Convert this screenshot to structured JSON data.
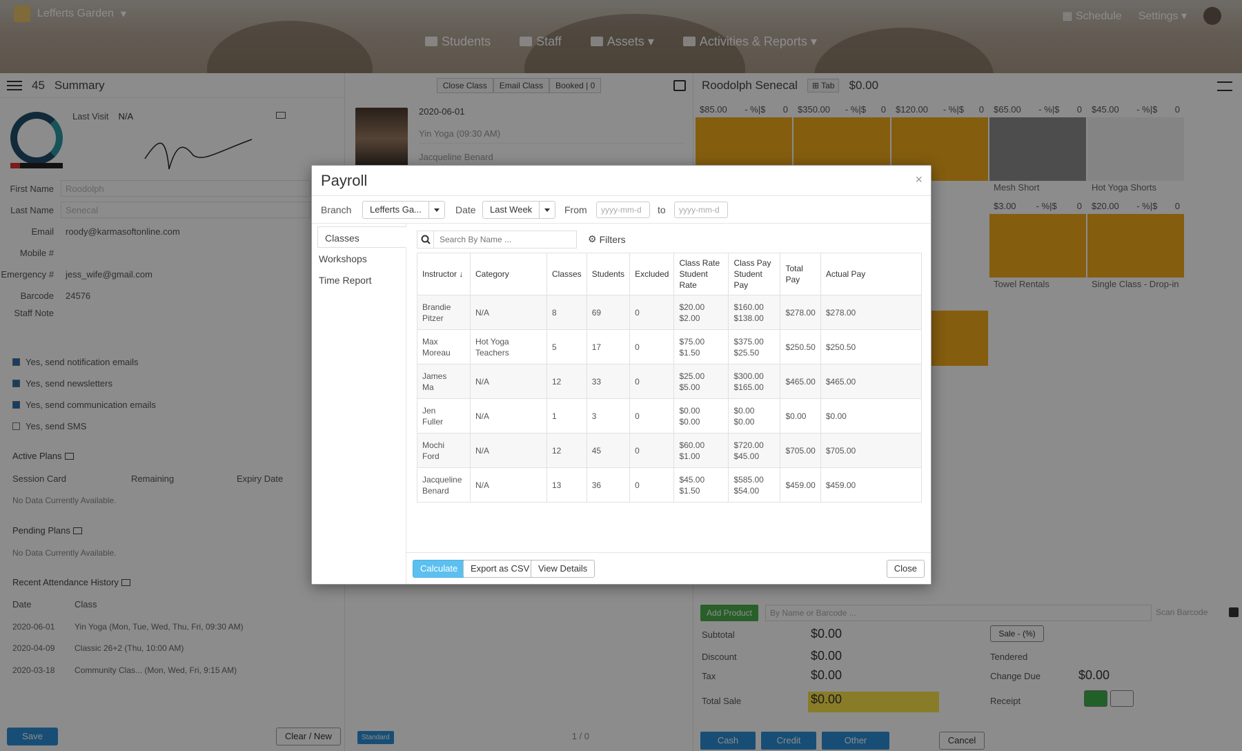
{
  "app": {
    "brand": "Lefferts Garden",
    "nav_right": [
      "Schedule",
      "Settings"
    ],
    "main_nav": [
      "Students",
      "Staff",
      "Assets",
      "Activities & Reports"
    ]
  },
  "summary": {
    "count": "45",
    "title": "Summary",
    "last_visit_label": "Last Visit",
    "last_visit_value": "N/A",
    "fields": [
      {
        "label": "First Name",
        "value": "Roodolph"
      },
      {
        "label": "Last Name",
        "value": "Senecal"
      },
      {
        "label": "Email",
        "value": "roody@karmasoftonline.com"
      },
      {
        "label": "Mobile #",
        "value": ""
      },
      {
        "label": "Emergency #",
        "value": "jess_wife@gmail.com"
      },
      {
        "label": "Barcode",
        "value": "24576"
      },
      {
        "label": "Staff Note",
        "value": ""
      }
    ],
    "checkboxes": [
      {
        "label": "Yes, send notification emails",
        "checked": true
      },
      {
        "label": "Yes, send newsletters",
        "checked": true
      },
      {
        "label": "Yes, send communication emails",
        "checked": true
      },
      {
        "label": "Yes, send SMS",
        "checked": false
      }
    ],
    "active_plans": {
      "title": "Active Plans",
      "columns": [
        "Session Card",
        "Remaining",
        "Expiry Date"
      ],
      "empty": "No Data Currently Available."
    },
    "pending_plans": {
      "title": "Pending Plans",
      "empty": "No Data Currently Available."
    },
    "attendance": {
      "title": "Recent Attendance History",
      "columns": [
        "Date",
        "Class"
      ],
      "rows": [
        {
          "date": "2020-06-01",
          "class": "Yin Yoga (Mon, Tue, Wed, Thu, Fri, 09:30 AM)"
        },
        {
          "date": "2020-04-09",
          "class": "Classic 26+2 (Thu, 10:00 AM)"
        },
        {
          "date": "2020-03-18",
          "class": "Community Clas... (Mon, Wed, Fri, 9:15 AM)"
        }
      ]
    },
    "save_label": "Save",
    "clear_label": "Clear / New"
  },
  "middle": {
    "buttons": [
      "Close Class",
      "Email Class",
      "Booked | 0"
    ],
    "date": "2020-06-01",
    "class_select": "Yin Yoga (09:30 AM)",
    "instructor_select": "Jacqueline Benard",
    "standard_label": "Standard",
    "pager": "1 / 0"
  },
  "pos": {
    "customer": "Roodolph Senecal",
    "tab_label": "Tab",
    "balance": "$0.00",
    "tiles_row1": [
      {
        "price": "$85.00",
        "pct": "- %|$",
        "qty": "0",
        "name": ""
      },
      {
        "price": "$350.00",
        "pct": "- %|$",
        "qty": "0",
        "name": ""
      },
      {
        "price": "$120.00",
        "pct": "- %|$",
        "qty": "0",
        "name": ""
      },
      {
        "price": "$65.00",
        "pct": "- %|$",
        "qty": "0",
        "name": "Mesh Short"
      },
      {
        "price": "$45.00",
        "pct": "- %|$",
        "qty": "0",
        "name": "Hot Yoga Shorts"
      }
    ],
    "tiles_row2": [
      {
        "price": "$3.00",
        "pct": "- %|$",
        "qty": "0",
        "name": "Towel Rentals"
      },
      {
        "price": "$20.00",
        "pct": "- %|$",
        "qty": "0",
        "name": "Single Class - Drop-in"
      }
    ],
    "add_product": "Add Product",
    "search_placeholder": "By Name or Barcode ...",
    "scan_barcode": "Scan Barcode",
    "subtotal_label": "Subtotal",
    "subtotal": "$0.00",
    "discount_label": "Discount",
    "discount": "$0.00",
    "tax_label": "Tax",
    "tax": "$0.00",
    "total_label": "Total Sale",
    "total": "$0.00",
    "sale_btn": "Sale - (%)",
    "tendered_label": "Tendered",
    "change_label": "Change Due",
    "change": "$0.00",
    "receipt_label": "Receipt",
    "pay_buttons": [
      "Cash",
      "Credit",
      "Other"
    ],
    "cancel_label": "Cancel"
  },
  "payroll": {
    "title": "Payroll",
    "close_x": "×",
    "branch_label": "Branch",
    "branch_value": "Lefferts Ga...",
    "date_label": "Date",
    "date_value": "Last Week",
    "from_label": "From",
    "from_placeholder": "yyyy-mm-d",
    "to_label": "to",
    "to_placeholder": "yyyy-mm-d",
    "tabs": [
      "Classes",
      "Workshops",
      "Time Report"
    ],
    "search_placeholder": "Search By Name ...",
    "filters_label": "Filters",
    "columns": [
      "Instructor",
      "Category",
      "Classes",
      "Students",
      "Excluded",
      "Class Rate\nStudent Rate",
      "Class Pay\nStudent Pay",
      "Total Pay",
      "Actual Pay"
    ],
    "rows": [
      {
        "first": "Brandie",
        "last": "Pitzer",
        "category": "N/A",
        "classes": "8",
        "students": "69",
        "excluded": "0",
        "rate1": "$20.00",
        "rate2": "$2.00",
        "pay1": "$160.00",
        "pay2": "$138.00",
        "total": "$278.00",
        "actual": "$278.00"
      },
      {
        "first": "Max",
        "last": "Moreau",
        "category": "Hot Yoga Teachers",
        "classes": "5",
        "students": "17",
        "excluded": "0",
        "rate1": "$75.00",
        "rate2": "$1.50",
        "pay1": "$375.00",
        "pay2": "$25.50",
        "total": "$250.50",
        "actual": "$250.50"
      },
      {
        "first": "James",
        "last": "Ma",
        "category": "N/A",
        "classes": "12",
        "students": "33",
        "excluded": "0",
        "rate1": "$25.00",
        "rate2": "$5.00",
        "pay1": "$300.00",
        "pay2": "$165.00",
        "total": "$465.00",
        "actual": "$465.00"
      },
      {
        "first": "Jen",
        "last": "Fuller",
        "category": "N/A",
        "classes": "1",
        "students": "3",
        "excluded": "0",
        "rate1": "$0.00",
        "rate2": "$0.00",
        "pay1": "$0.00",
        "pay2": "$0.00",
        "total": "$0.00",
        "actual": "$0.00"
      },
      {
        "first": "Mochi",
        "last": "Ford",
        "category": "N/A",
        "classes": "12",
        "students": "45",
        "excluded": "0",
        "rate1": "$60.00",
        "rate2": "$1.00",
        "pay1": "$720.00",
        "pay2": "$45.00",
        "total": "$705.00",
        "actual": "$705.00"
      },
      {
        "first": "Jacqueline",
        "last": "Benard",
        "category": "N/A",
        "classes": "13",
        "students": "36",
        "excluded": "0",
        "rate1": "$45.00",
        "rate2": "$1.50",
        "pay1": "$585.00",
        "pay2": "$54.00",
        "total": "$459.00",
        "actual": "$459.00"
      }
    ],
    "buttons": {
      "calculate": "Calculate",
      "export": "Export as CSV",
      "details": "View Details",
      "close": "Close"
    }
  },
  "colors": {
    "primary": "#2d8fd5",
    "calculate": "#5bc0f0",
    "tile": "#f0a91c",
    "total_highlight": "#f7e24a",
    "add_product": "#4cae4c"
  }
}
